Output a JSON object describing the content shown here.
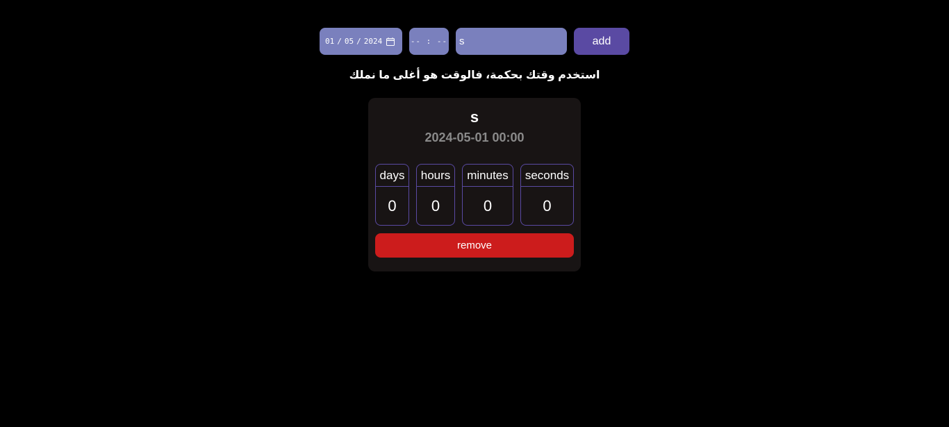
{
  "form": {
    "date": {
      "day": "01",
      "month": "05",
      "year": "2024",
      "separator": "/"
    },
    "time_placeholder": "-- : --",
    "name_value": "s",
    "add_label": "add",
    "calendar_icon": "calendar-icon"
  },
  "motto": "استخدم وقتك بحكمة، فالوقت هو أغلى ما نملك",
  "countdown": {
    "title": "s",
    "datetime": "2024-05-01 00:00",
    "units": {
      "days": {
        "label": "days",
        "value": "0"
      },
      "hours": {
        "label": "hours",
        "value": "0"
      },
      "minutes": {
        "label": "minutes",
        "value": "0"
      },
      "seconds": {
        "label": "seconds",
        "value": "0"
      }
    },
    "remove_label": "remove"
  },
  "colors": {
    "background": "#000000",
    "input_bg": "#7a80bd",
    "add_button": "#5a4aa3",
    "card_bg": "#181414",
    "unit_border": "#5a4aa3",
    "remove_button": "#cc1c1c",
    "datetime_text": "#8a8a8a"
  }
}
